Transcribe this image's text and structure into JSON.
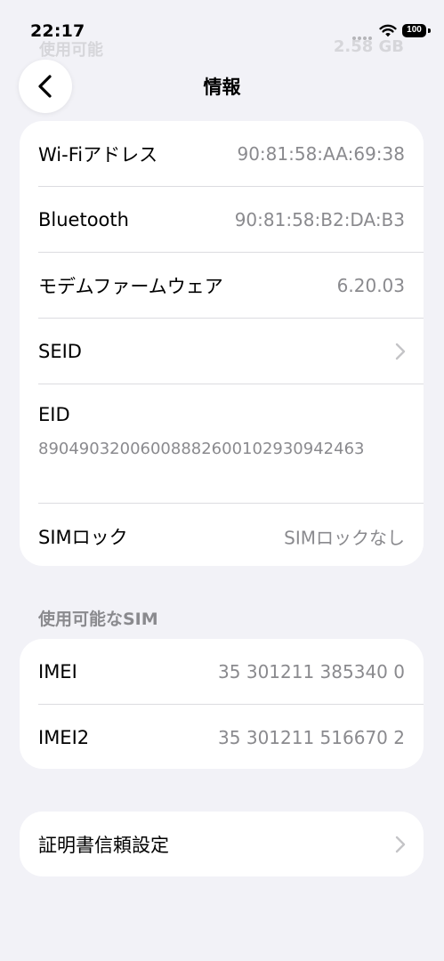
{
  "status_bar": {
    "time": "22:17",
    "battery": "100"
  },
  "ghost": {
    "left": "使用可能",
    "right": "2.58 GB"
  },
  "nav": {
    "title": "情報"
  },
  "info_card": {
    "rows": [
      {
        "label": "Wi-Fiアドレス",
        "value": "90:81:58:AA:69:38"
      },
      {
        "label": "Bluetooth",
        "value": "90:81:58:B2:DA:B3"
      },
      {
        "label": "モデムファームウェア",
        "value": "6.20.03"
      },
      {
        "label": "SEID"
      },
      {
        "label": "EID",
        "value": "89049032006008882600102930942463"
      },
      {
        "label": "SIMロック",
        "value": "SIMロックなし"
      }
    ]
  },
  "sim_section": {
    "header": "使用可能なSIM",
    "rows": [
      {
        "label": "IMEI",
        "value": "35 301211 385340 0"
      },
      {
        "label": "IMEI2",
        "value": "35 301211 516670 2"
      }
    ]
  },
  "cert_card": {
    "label": "証明書信頼設定"
  },
  "icons": [
    "back-chevron-icon",
    "chevron-right-icon",
    "wifi-icon",
    "battery-icon"
  ]
}
